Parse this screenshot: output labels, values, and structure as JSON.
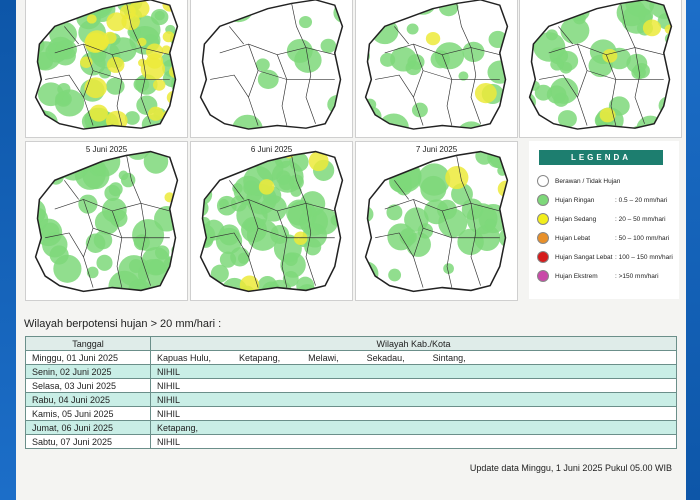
{
  "maps": [
    {
      "date": "",
      "density": 0.85,
      "yellow": 0.35
    },
    {
      "date": "",
      "density": 0.12,
      "yellow": 0.0
    },
    {
      "date": "",
      "density": 0.3,
      "yellow": 0.03
    },
    {
      "date": "",
      "density": 0.5,
      "yellow": 0.05
    },
    {
      "date": "5 Juni 2025",
      "density": 0.6,
      "yellow": 0.02
    },
    {
      "date": "6 Juni 2025",
      "density": 0.75,
      "yellow": 0.06
    },
    {
      "date": "7 Juni 2025",
      "density": 0.45,
      "yellow": 0.02
    }
  ],
  "legend": {
    "title": "LEGENDA",
    "items": [
      {
        "label": "Berawan / Tidak Hujan",
        "range": "",
        "color": "#ffffff"
      },
      {
        "label": "Hujan Ringan",
        "range": ": 0.5 – 20 mm/hari",
        "color": "#7ed87a"
      },
      {
        "label": "Hujan Sedang",
        "range": ": 20 – 50 mm/hari",
        "color": "#f2ee1c"
      },
      {
        "label": "Hujan Lebat",
        "range": ": 50 – 100 mm/hari",
        "color": "#e8902a"
      },
      {
        "label": "Hujan Sangat Lebat",
        "range": ": 100 – 150 mm/hari",
        "color": "#d51b1b"
      },
      {
        "label": "Hujan Ekstrem",
        "range": ": >150 mm/hari",
        "color": "#c94aa8"
      }
    ]
  },
  "subtitle": "Wilayah berpotensi hujan > 20 mm/hari :",
  "table": {
    "headers": [
      "Tanggal",
      "Wilayah Kab./Kota"
    ],
    "rows": [
      {
        "day": "Minggu, 01 Juni 2025",
        "regions": [
          "Kapuas Hulu,",
          "Ketapang,",
          "Melawi,",
          "Sekadau,",
          "Sintang,"
        ]
      },
      {
        "day": "Senin, 02 Juni 2025",
        "regions": [
          "NIHIL"
        ]
      },
      {
        "day": "Selasa, 03 Juni 2025",
        "regions": [
          "NIHIL"
        ]
      },
      {
        "day": "Rabu, 04 Juni 2025",
        "regions": [
          "NIHIL"
        ]
      },
      {
        "day": "Kamis, 05 Juni 2025",
        "regions": [
          "NIHIL"
        ]
      },
      {
        "day": "Jumat, 06 Juni 2025",
        "regions": [
          "Ketapang,"
        ]
      },
      {
        "day": "Sabtu, 07 Juni 2025",
        "regions": [
          "NIHIL"
        ]
      }
    ]
  },
  "update_text": "Update data Minggu, 1 Juni 2025 Pukul 05.00 WIB"
}
